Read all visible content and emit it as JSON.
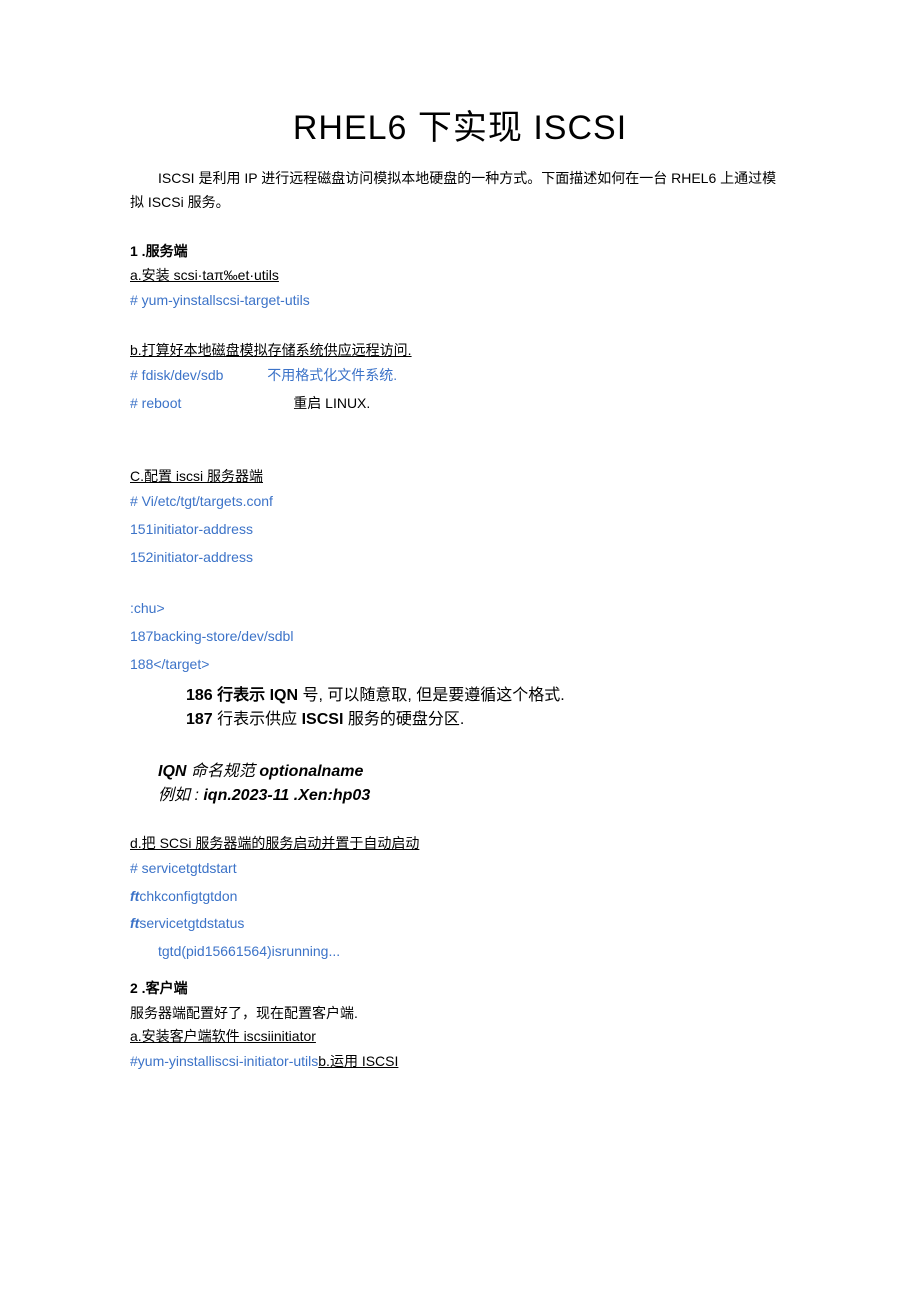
{
  "title": "RHEL6 下实现 ISCSI",
  "intro": "ISCSI 是利用 IP 进行远程磁盘访问模拟本地硬盘的一种方式。下面描述如何在一台 RHEL6 上通过模拟 ISCSi 服务。",
  "s1": {
    "head": "1  .服务端",
    "a_head": "a.安装 scsi·taπ‰et·utils",
    "a_cmd1": "#    yum-yinstallscsi-target-utils",
    "b_head": "b.打算好本地磁盘模拟存储系统供应远程访问.",
    "b_cmd1_l": "#    fdisk/dev/sdb",
    "b_cmd1_r": "不用格式化文件系统.",
    "b_cmd2_l": "#    reboot",
    "b_cmd2_r": "重启 LINUX.",
    "c_head": "C.配置 iscsi 服务器端",
    "c_cmd1": "#    Vi/etc/tgt/targets.conf",
    "c_cmd2": "151initiator-address",
    "c_cmd3": "152initiator-address",
    "c_cmd4": ":chu>",
    "c_cmd5": "187backing-store/dev/sdbl",
    "c_cmd6": "188</target>",
    "c_note1_a": "186 行表示 ",
    "c_note1_b": "IQN",
    "c_note1_c": " 号, 可以随意取, 但是要遵循这个格式.",
    "c_note2_a": "187",
    "c_note2_b": " 行表示供应 ",
    "c_note2_c": "ISCSI",
    "c_note2_d": " 服务的硬盘分区.",
    "c_iqn1_a": "IQN ",
    "c_iqn1_b": "命名规范 ",
    "c_iqn1_c": "optionalname",
    "c_iqn2_a": "例如 : ",
    "c_iqn2_b": "iqn.2023-11     .Xen:hp03",
    "d_head": "d.把 SCSi 服务器端的服务启动并置于自动启动",
    "d_cmd1": "#    servicetgtdstart",
    "d_cmd2_ft": "ft",
    "d_cmd2": "chkconfigtgtdon",
    "d_cmd3_ft": "ft",
    "d_cmd3": "servicetgtdstatus",
    "d_cmd4": "tgtd(pid15661564)isrunning..."
  },
  "s2": {
    "head": "2  .客户端",
    "line1": "服务器端配置好了，现在配置客户端.",
    "a_head": "a.安装客户端软件 iscsiinitiator",
    "a_cmd1": "#yum-yinstalliscsi-initiator-utils",
    "a_b": "b.运用 ISCSI"
  }
}
